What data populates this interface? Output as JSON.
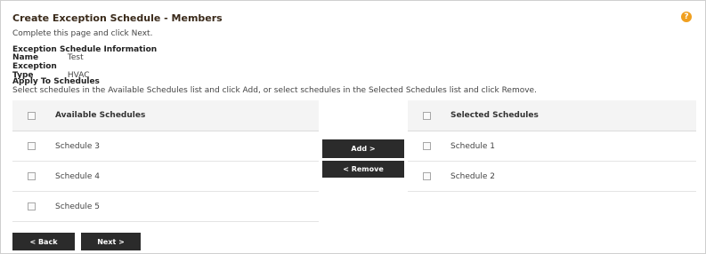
{
  "page": {
    "title": "Create Exception Schedule - Members",
    "instruction": "Complete this page and click Next.",
    "help_icon": "?"
  },
  "exception_info": {
    "heading": "Exception Schedule Information",
    "name_label": "Name",
    "name_value": "Test",
    "type_label": "Exception Type",
    "type_value": "HVAC"
  },
  "apply": {
    "heading": "Apply To Schedules",
    "description": "Select schedules in the Available Schedules list and click Add, or select schedules in the Selected Schedules list and click Remove."
  },
  "available": {
    "header": "Available Schedules",
    "items": [
      "Schedule 3",
      "Schedule 4",
      "Schedule 5"
    ]
  },
  "selected": {
    "header": "Selected Schedules",
    "items": [
      "Schedule 1",
      "Schedule 2"
    ]
  },
  "buttons": {
    "add": "Add >",
    "remove": "< Remove",
    "back": "< Back",
    "next": "Next >"
  },
  "colors": {
    "button_bg": "#2b2b2b",
    "help_icon": "#f0a020",
    "title": "#3a2a1a"
  }
}
